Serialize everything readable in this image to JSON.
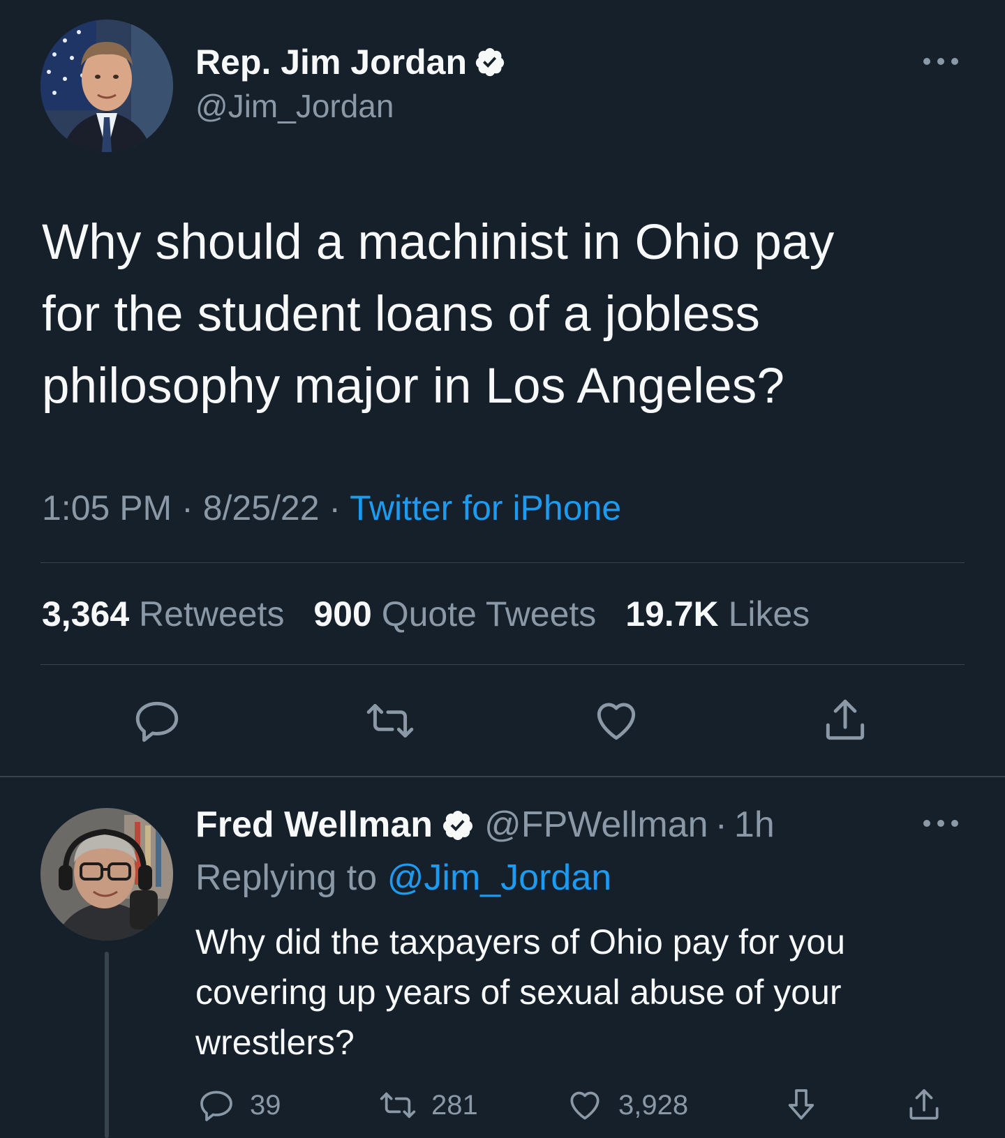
{
  "main_tweet": {
    "display_name": "Rep. Jim Jordan",
    "handle": "@Jim_Jordan",
    "text": "Why should a machinist in Ohio pay\nfor the student loans of a jobless\nphilosophy major in Los Angeles?",
    "time": "1:05 PM",
    "date": "8/25/22",
    "separator": "·",
    "source": "Twitter for iPhone",
    "stats": {
      "retweets_count": "3,364",
      "retweets_label": "Retweets",
      "quotes_count": "900",
      "quotes_label": "Quote Tweets",
      "likes_count": "19.7K",
      "likes_label": "Likes"
    },
    "icons": [
      "reply-icon",
      "retweet-icon",
      "like-icon",
      "share-icon"
    ]
  },
  "reply_tweet": {
    "display_name": "Fred Wellman",
    "handle": "@FPWellman",
    "separator": "·",
    "age": "1h",
    "replying_prefix": "Replying to",
    "replying_to": "@Jim_Jordan",
    "text": "Why did the taxpayers of Ohio pay for you\ncovering up years of sexual abuse of your\nwrestlers?",
    "replies": "39",
    "retweets": "281",
    "likes": "3,928",
    "icons": [
      "reply-icon",
      "retweet-icon",
      "like-icon",
      "download-icon",
      "share-icon"
    ]
  },
  "colors": {
    "background": "#15202b",
    "text": "#f7f9f9",
    "secondary": "#8b98a5",
    "accent": "#1d9bf0",
    "divider": "#38444d"
  }
}
